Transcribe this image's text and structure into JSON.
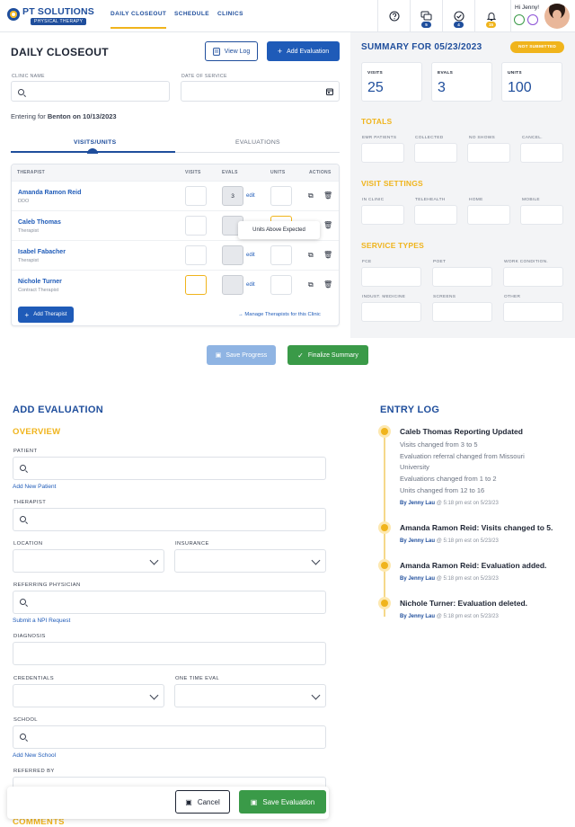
{
  "brand": {
    "name": "PT SOLUTIONS",
    "sub": "PHYSICAL THERAPY"
  },
  "nav": [
    {
      "label": "DAILY CLOSEOUT",
      "active": true
    },
    {
      "label": "SCHEDULE",
      "active": false
    },
    {
      "label": "CLINICS",
      "active": false
    }
  ],
  "topicons": [
    {
      "icon": "help-circle-icon",
      "badge": ""
    },
    {
      "icon": "chat-icon",
      "badge": "5"
    },
    {
      "icon": "check-circle-icon",
      "badge": "4"
    },
    {
      "icon": "bell-icon",
      "badge": "15"
    }
  ],
  "profile": {
    "greeting": "Hi Jenny!"
  },
  "closeout": {
    "title": "DAILY CLOSEOUT",
    "view_log": "View Log",
    "add_evaluation": "Add Evaluation",
    "clinic_label": "CLINIC NAME",
    "date_label": "DATE OF SERVICE",
    "entering_prefix": "Entering for",
    "entering_clinic": "Benton",
    "entering_date": "on 10/13/2023",
    "tabs": [
      "VISITS/UNITS",
      "EVALUATIONS"
    ],
    "columns": [
      "THERAPIST",
      "VISITS",
      "EVALS",
      "UNITS",
      "ACTIONS"
    ],
    "rows": [
      {
        "name": "Amanda Ramon Reid",
        "role": "DDO",
        "evals": "3",
        "edit": "edit"
      },
      {
        "name": "Caleb Thomas",
        "role": "Therapist",
        "evals": "",
        "edit": "edit"
      },
      {
        "name": "Isabel Fabacher",
        "role": "Therapist",
        "evals": "",
        "edit": "edit"
      },
      {
        "name": "Nichole Turner",
        "role": "Contract Therapist",
        "evals": "",
        "edit": "edit"
      }
    ],
    "tooltip": "Units Above Expected",
    "add_therapist": "Add Therapist",
    "manage": "Manage Therapists for this Clinic",
    "save_progress": "Save Progress",
    "finalize": "Finalize Summary"
  },
  "summary": {
    "title": "SUMMARY FOR 05/23/2023",
    "status": "NOT SUBMITTED",
    "cards": [
      {
        "label": "VISITS",
        "value": "25"
      },
      {
        "label": "EVALS",
        "value": "3"
      },
      {
        "label": "UNITS",
        "value": "100"
      }
    ],
    "totals_title": "TOTALS",
    "totals": [
      "EMR PATIENTS",
      "COLLECTED",
      "NO SHOWS",
      "CANCEL."
    ],
    "visit_title": "VISIT SETTINGS",
    "visit": [
      "IN CLINIC",
      "TELEHEALTH",
      "HOME",
      "MOBILE"
    ],
    "service_title": "SERVICE TYPES",
    "service": [
      "FCE",
      "POET",
      "WORK CONDITION.",
      "INDUST. MEDICINE",
      "SCREENS",
      "OTHER"
    ]
  },
  "evaluation": {
    "title": "ADD EVALUATION",
    "overview": "OVERVIEW",
    "patient": "PATIENT",
    "add_patient": "Add New Patient",
    "therapist": "THERAPIST",
    "location": "LOCATION",
    "insurance": "INSURANCE",
    "referring": "REFERRING PHYSICIAN",
    "npi": "Submit a NPI Request",
    "diagnosis": "DIAGNOSIS",
    "credentials": "CREDENTIALS",
    "one_time": "ONE TIME EVAL",
    "school": "SCHOOL",
    "add_school": "Add New School",
    "referred_by": "REFERRED BY",
    "comments": "COMMENTS",
    "cancel": "Cancel",
    "save": "Save Evaluation"
  },
  "entry_log": {
    "title": "ENTRY LOG",
    "entries": [
      {
        "title": "Caleb Thomas Reporting Updated",
        "details": [
          "Visits changed from 3 to 5",
          "Evaluation referral changed from Missouri",
          "University",
          "Evaluations changed from 1 to 2",
          "Units changed from 12 to 16"
        ],
        "by": "By Jenny Lau",
        "when": "@ 5:18 pm est on 5/23/23"
      },
      {
        "title": "Amanda Ramon Reid: Visits changed to 5.",
        "details": [],
        "by": "By Jenny Lau",
        "when": "@ 5:18 pm est on 5/23/23"
      },
      {
        "title": "Amanda Ramon Reid: Evaluation added.",
        "details": [],
        "by": "By Jenny Lau",
        "when": "@ 5:18 pm est on 5/23/23"
      },
      {
        "title": "Nichole Turner: Evaluation deleted.",
        "details": [],
        "by": "By Jenny Lau",
        "when": "@ 5:18 pm est on 5/23/23"
      }
    ]
  },
  "colors": {
    "brand_blue": "#1f4e9c",
    "accent_yellow": "#f0b41c",
    "success_green": "#3a9a48"
  }
}
